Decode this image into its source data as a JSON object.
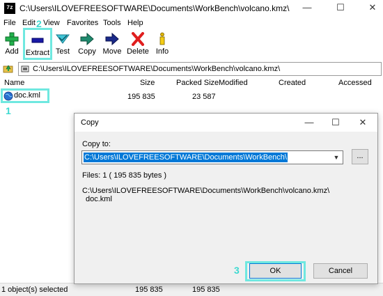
{
  "window": {
    "title": "C:\\Users\\ILOVEFREESOFTWARE\\Documents\\WorkBench\\volcano.kmz\\",
    "app_icon": "7z",
    "minimize": "—",
    "maximize": "☐",
    "close": "✕"
  },
  "menu": [
    "File",
    "Edit",
    "View",
    "Favorites",
    "Tools",
    "Help"
  ],
  "toolbar": {
    "add": "Add",
    "extract": "Extract",
    "test": "Test",
    "copy": "Copy",
    "move": "Move",
    "delete": "Delete",
    "info": "Info"
  },
  "address": {
    "path": "C:\\Users\\ILOVEFREESOFTWARE\\Documents\\WorkBench\\volcano.kmz\\"
  },
  "columns": {
    "name": "Name",
    "size": "Size",
    "packed_size": "Packed Size",
    "modified": "Modified",
    "created": "Created",
    "accessed": "Accessed"
  },
  "files": [
    {
      "name": "doc.kml",
      "size": "195 835",
      "packed_size": "23 587"
    }
  ],
  "annotations": {
    "one": "1",
    "two": "2",
    "three": "3"
  },
  "status": {
    "selected": "1 object(s) selected",
    "size": "195 835",
    "packed": "195 835"
  },
  "dialog": {
    "title": "Copy",
    "copy_to_label": "Copy to:",
    "copy_to_value": "C:\\Users\\ILOVEFREESOFTWARE\\Documents\\WorkBench\\",
    "browse": "...",
    "files_info": "Files: 1    ( 195 835 bytes )",
    "source_path": "C:\\Users\\ILOVEFREESOFTWARE\\Documents\\WorkBench\\volcano.kmz\\",
    "source_file": "doc.kml",
    "ok": "OK",
    "cancel": "Cancel",
    "minimize": "—",
    "maximize": "☐",
    "close": "✕"
  },
  "colors": {
    "highlight": "#6fe8e0",
    "annotation": "#3dd9d0",
    "selection": "#0078d7"
  }
}
